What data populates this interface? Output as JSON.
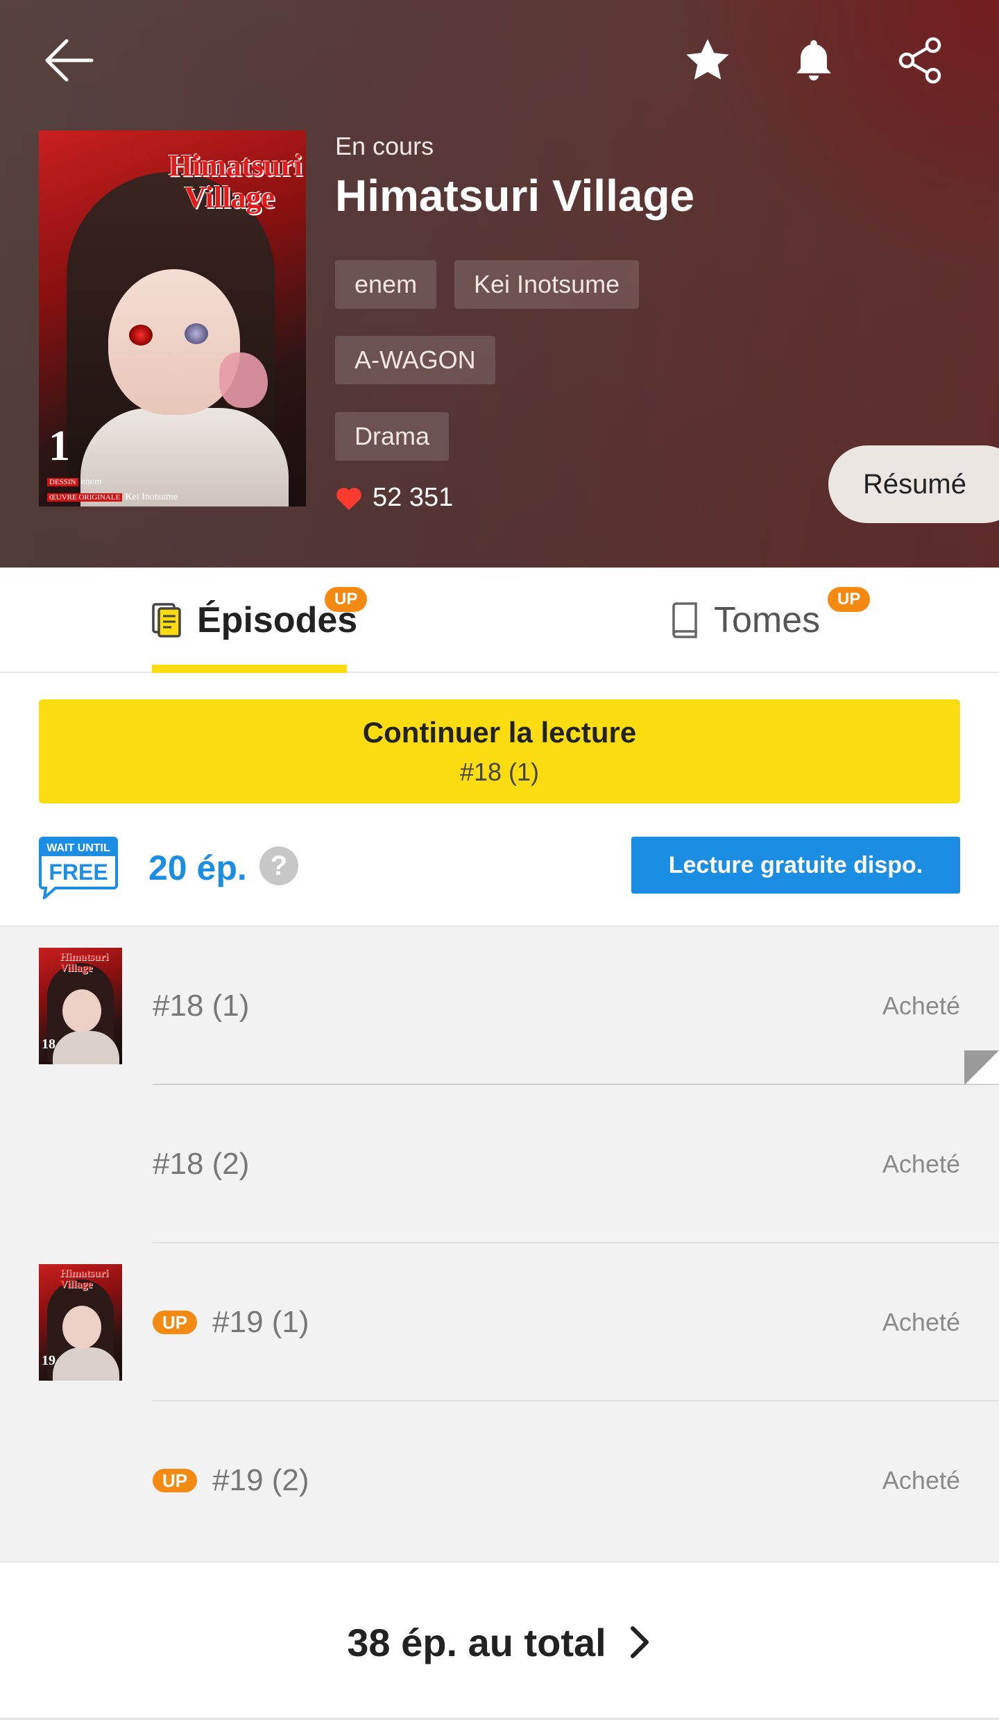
{
  "header": {
    "status": "En cours",
    "title": "Himatsuri Village",
    "tags": [
      "enem",
      "Kei Inotsume",
      "A-WAGON",
      "Drama"
    ],
    "likes": "52 351",
    "resume_label": "Résumé",
    "icons": [
      "back-arrow-icon",
      "star-icon",
      "bell-icon",
      "share-icon",
      "heart-icon"
    ]
  },
  "cover": {
    "title_line1": "Himatsuri",
    "title_line2": "Village",
    "volume": "1",
    "credit_drawing_tag": "DESSIN",
    "credit_drawing": "enem",
    "credit_story_tag": "ŒUVRE ORIGINALE",
    "credit_story": "Kei Inotsume"
  },
  "tabs": {
    "episodes_label": "Épisodes",
    "tomes_label": "Tomes",
    "badge": "UP",
    "active": "Épisodes"
  },
  "continue": {
    "label": "Continuer la lecture",
    "episode": "#18 (1)"
  },
  "wait_until_free": {
    "logo_line1": "WAIT UNTIL",
    "logo_line2": "FREE",
    "count": "20 ép.",
    "help": "?",
    "button": "Lecture gratuite dispo."
  },
  "episodes": [
    {
      "label": "#18 (1)",
      "status": "Acheté",
      "badge": "",
      "thumb_num": "18"
    },
    {
      "label": "#18 (2)",
      "status": "Acheté",
      "badge": "",
      "thumb_num": ""
    },
    {
      "label": "#19 (1)",
      "status": "Acheté",
      "badge": "UP",
      "thumb_num": "19"
    },
    {
      "label": "#19 (2)",
      "status": "Acheté",
      "badge": "UP",
      "thumb_num": ""
    }
  ],
  "footer": {
    "total": "38 ép. au total"
  },
  "colors": {
    "accent_yellow": "#fbdc11",
    "accent_blue": "#1b8ee3",
    "badge_orange": "#f58a12",
    "heart_red": "#ff3b30"
  }
}
